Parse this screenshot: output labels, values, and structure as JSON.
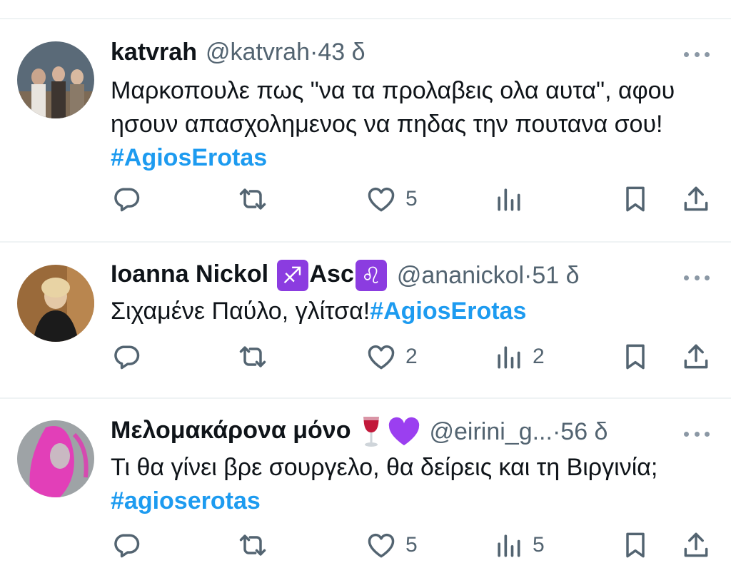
{
  "tweets": [
    {
      "name": "katvrah",
      "handle": "@katvrah",
      "sep": " · ",
      "time": "43 δ",
      "text": "Μαρκοπουλε πως \"να τα προλαβεις ολα αυτα\", αφου ησουν απασχολημενος να πηδας την πουτανα σου! ",
      "hashtag": "#AgiosErotas",
      "likes": "5",
      "views": ""
    },
    {
      "name_part1": "Ioanna Nickol ",
      "sag_glyph": "♐",
      "name_part2": "Asc",
      "leo_glyph": "♌",
      "handle": "@ananickol",
      "sep": " · ",
      "time": "51 δ",
      "text": "Σιχαμένε Παύλο, γλίτσα!",
      "hashtag": "#AgiosErotas",
      "likes": "2",
      "views": "2"
    },
    {
      "name": "Μελομακάρονα μόνο",
      "handle": "@eirini_g...",
      "sep": " · ",
      "time": "56 δ",
      "text": "Τι θα γίνει βρε σουργελο, θα δείρεις και τη Βιργινία; ",
      "hashtag": "#agioserotas",
      "likes": "5",
      "views": "5"
    }
  ],
  "colors": {
    "hashtag": "#1d9bf0",
    "meta": "#536471",
    "divider": "#eff3f4",
    "emoji_purple": "#8b3ce0"
  },
  "icons": [
    "reply-icon",
    "retweet-icon",
    "like-icon",
    "views-icon",
    "bookmark-icon",
    "share-icon",
    "more-icon"
  ]
}
